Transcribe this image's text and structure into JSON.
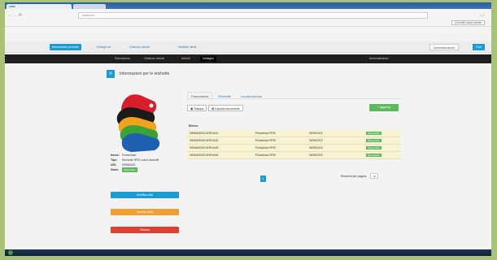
{
  "os": {
    "tab_title": "cosa",
    "tab2_title": "",
    "taskbar_time": ""
  },
  "browser": {
    "nav_glyphs": "← → ⟳",
    "url": "localhost/...",
    "tools_glyphs": "☆ ≡",
    "login_label": "Connetti come utente"
  },
  "app_nav": {
    "items": [
      {
        "label": "Informazioni prodotto",
        "active": true
      },
      {
        "label": "Dettagli art.",
        "active": false
      },
      {
        "label": "Gestione articoli",
        "active": false
      },
      {
        "label": "Visibilità utenti",
        "active": false
      }
    ],
    "right_items": [
      "Amministrazione",
      "Esci"
    ]
  },
  "menubar": {
    "items": [
      {
        "label": "Panoramica",
        "active": false
      },
      {
        "label": "Gestione articoli",
        "active": false
      },
      {
        "label": "Articoli",
        "active": false
      },
      {
        "label": "Dettaglio",
        "active": true
      }
    ],
    "right_label": "Amministratore"
  },
  "page": {
    "header_icon": "info-icon",
    "title": "Informazioni per le etichette"
  },
  "product": {
    "name_label": "Nome:",
    "name_value": "Portachiavi",
    "type_label": "Tipo:",
    "type_value": "Etichette RFID colori assortiti",
    "code_label": "UID:",
    "code_value": "0905A00D",
    "state_label": "Stato:",
    "state_value": "Disponibile"
  },
  "side_buttons": [
    {
      "label": "Modifica dati",
      "color": "#1a9bd6"
    },
    {
      "label": "Cambia stato",
      "color": "#f0a030"
    },
    {
      "label": "Elimina",
      "color": "#e04030"
    }
  ],
  "tabs": [
    {
      "label": "Panoramica",
      "active": true
    },
    {
      "label": "Etichette",
      "active": false
    },
    {
      "label": "Localizzazione",
      "active": false
    }
  ],
  "toolbar": {
    "print_label": "Stampa",
    "export_label": "Esporta documento",
    "add_label": "Aggiungi"
  },
  "grid": {
    "title": "Elenco",
    "rows": [
      {
        "code": "0905A00D0C4E9F4A01",
        "type": "Portachiavi RFID",
        "date": "05/09/2019",
        "status": "Disponibile"
      },
      {
        "code": "0905A00D0C4E9F4A02",
        "type": "Portachiavi RFID",
        "date": "05/09/2019",
        "status": "Disponibile"
      },
      {
        "code": "0905A00D0C4E9F4A03",
        "type": "Portachiavi RFID",
        "date": "05/09/2019",
        "status": "Disponibile"
      },
      {
        "code": "0905A00D0C4E9F4A04",
        "type": "Portachiavi RFID",
        "date": "05/09/2019",
        "status": "Disponibile"
      }
    ]
  },
  "pager": {
    "current_page": "1",
    "per_page_label": "Elementi per pagina:",
    "per_page_value": "10"
  },
  "colors": {
    "accent": "#1a9bd6",
    "success": "#5cb85c",
    "warning": "#f0a030",
    "danger": "#e04030",
    "row_highlight": "#f7f2d2"
  }
}
